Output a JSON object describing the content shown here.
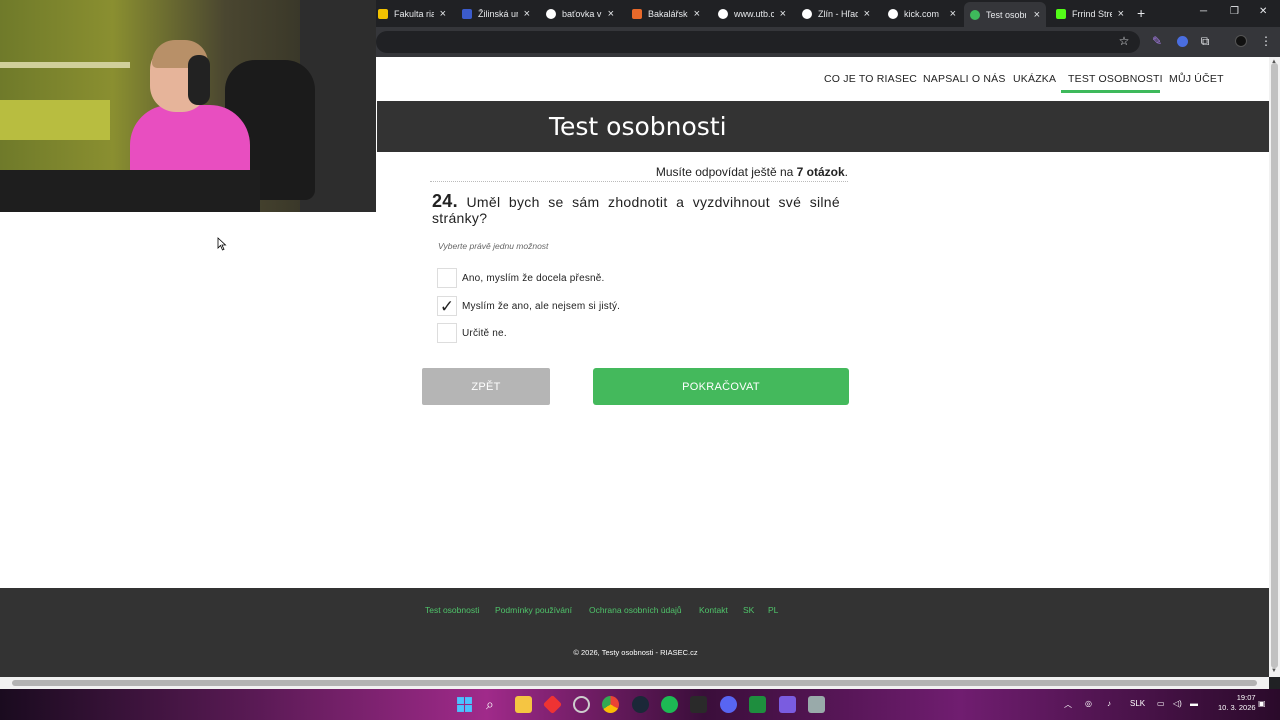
{
  "browser": {
    "tabs": [
      {
        "label": "Fakulta riad",
        "color": "#f2c200"
      },
      {
        "label": "Žilinská univ",
        "color": "#3b5bcc"
      },
      {
        "label": "baťovka v",
        "color": "#ffffff"
      },
      {
        "label": "Bakalářské",
        "color": "#e8692a"
      },
      {
        "label": "www.utb.c",
        "color": "#ffffff"
      },
      {
        "label": "Zlín - Hľad",
        "color": "#ffffff"
      },
      {
        "label": "kick.com",
        "color": "#ffffff"
      },
      {
        "label": "Test osobr",
        "color": "#3eb95b"
      },
      {
        "label": "Frrind Stre",
        "color": "#53fc18"
      }
    ],
    "active_tab": 7,
    "new_tab": "+",
    "close": "×"
  },
  "nav": {
    "items": [
      "CO JE TO RIASEC",
      "NAPSALI O NÁS",
      "UKÁZKA",
      "TEST OSOBNOSTI",
      "MŮJ ÚČET"
    ],
    "active": "TEST OSOBNOSTI"
  },
  "banner": {
    "title": "Test osobnosti"
  },
  "progress": {
    "prefix": "Musíte odpovídat ještě na",
    "count": "7 otázok",
    "suffix": "."
  },
  "question": {
    "number": "24.",
    "text": "Uměl bych se sám zhodnotit a vyzdvihnout své silné stránky?",
    "hint": "Vyberte právě jednu možnost",
    "options": [
      {
        "label": "Ano, myslím že docela přesně.",
        "checked": false
      },
      {
        "label": "Myslím že ano, ale nejsem si jistý.",
        "checked": true
      },
      {
        "label": "Určitě ne.",
        "checked": false
      }
    ],
    "check_mark": "✓"
  },
  "buttons": {
    "back": "ZPĚT",
    "next": "POKRAČOVAT"
  },
  "footer": {
    "links": [
      "Test osobnosti",
      "Podmínky používání",
      "Ochrana osobních údajů",
      "Kontakt",
      "SK",
      "PL"
    ],
    "copyright": "© 2026, Testy osobnosti - RIASEC.cz"
  },
  "taskbar": {
    "language": "SLK",
    "time": "19:07",
    "date": "10. 3. 2026"
  },
  "colors": {
    "accent": "#3eb95b",
    "banner": "#333333",
    "footer": "#333333",
    "back_button": "#b5b5b5",
    "next_button": "#44b95c"
  }
}
